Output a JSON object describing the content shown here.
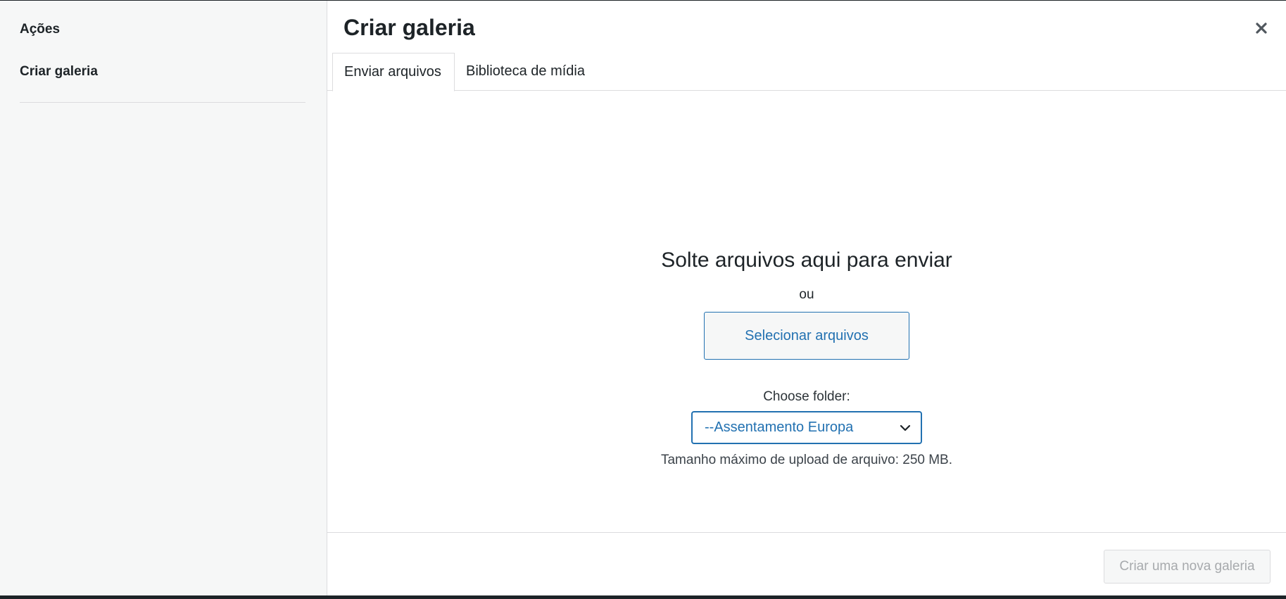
{
  "sidebar": {
    "heading": "Ações",
    "items": [
      {
        "label": "Criar galeria"
      }
    ]
  },
  "modal": {
    "title": "Criar galeria",
    "close_icon": "close-icon"
  },
  "tabs": [
    {
      "label": "Enviar arquivos",
      "active": true
    },
    {
      "label": "Biblioteca de mídia",
      "active": false
    }
  ],
  "upload": {
    "drop_text": "Solte arquivos aqui para enviar",
    "or_text": "ou",
    "select_button": "Selecionar arquivos",
    "folder_label": "Choose folder:",
    "folder_selected": "--Assentamento Europa",
    "max_size": "Tamanho máximo de upload de arquivo: 250 MB."
  },
  "footer": {
    "create_button": "Criar uma nova galeria"
  },
  "colors": {
    "accent": "#2271b1",
    "sidebar_bg": "#f6f7f7",
    "disabled_text": "#a7aaad"
  }
}
